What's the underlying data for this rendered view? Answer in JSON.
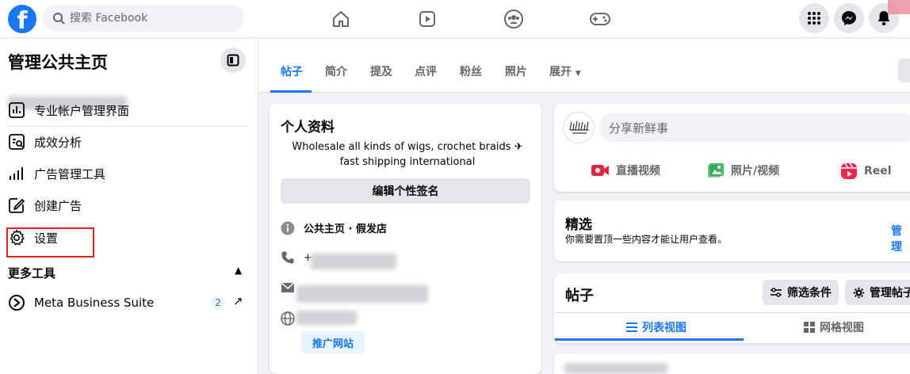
{
  "colors": {
    "brand": "#1877f2",
    "highlight": "#e02020",
    "background": "#f0f2f5"
  },
  "topbar": {
    "logo": "f",
    "search": {
      "placeholder": "搜索 Facebook",
      "value": ""
    },
    "nav_icons": [
      "home-icon",
      "video-icon",
      "groups-icon",
      "gaming-icon"
    ],
    "right_icons": [
      "menu-grid-icon",
      "messenger-icon",
      "bell-icon"
    ]
  },
  "sidebar": {
    "title": "管理公共主页",
    "items": [
      {
        "label": "专业帐户管理界面",
        "icon": "dashboard-icon"
      },
      {
        "label": "成效分析",
        "icon": "insights-icon"
      },
      {
        "label": "广告管理工具",
        "icon": "ads-manager-icon"
      },
      {
        "label": "创建广告",
        "icon": "create-ad-icon"
      },
      {
        "label": "设置",
        "icon": "gear-icon"
      }
    ],
    "more_tools": {
      "title": "更多工具",
      "items": [
        {
          "label": "Meta Business Suite",
          "badge": "2"
        }
      ]
    }
  },
  "tabs": [
    "帖子",
    "简介",
    "提及",
    "点评",
    "粉丝",
    "照片",
    "展开"
  ],
  "profile_card": {
    "title": "个人资料",
    "bio": "Wholesale all kinds of wigs, crochet braids ✈ fast shipping international",
    "edit_button": "编辑个性签名",
    "category": "公共主页 · 假发店",
    "phone_prefix": "+",
    "promote_button": "推广网站"
  },
  "composer": {
    "placeholder": "分享新鲜事",
    "actions": [
      {
        "label": "直播视频",
        "icon": "live-video-icon"
      },
      {
        "label": "照片/视频",
        "icon": "photo-video-icon"
      },
      {
        "label": "Reel",
        "icon": "reel-icon"
      }
    ]
  },
  "featured": {
    "title": "精选",
    "desc": "你需要置顶一些内容才能让用户查看。",
    "manage": "管理"
  },
  "posts": {
    "title": "帖子",
    "filter_button": "筛选条件",
    "manage_button": "管理帖子",
    "view_tabs": [
      {
        "label": "列表视图",
        "active": true
      },
      {
        "label": "网格视图",
        "active": false
      }
    ]
  }
}
